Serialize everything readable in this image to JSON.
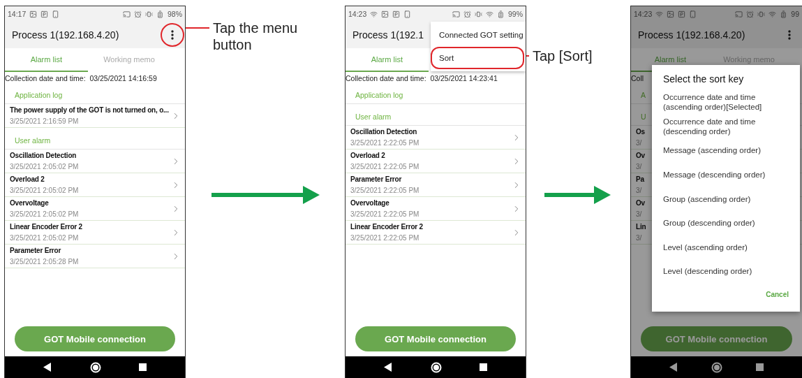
{
  "steps": [
    {
      "status_bar": {
        "time": "14:17",
        "wifi": false,
        "battery": "98%"
      },
      "app_bar": {
        "title": "Process 1(192.168.4.20)",
        "menu_button": {
          "highlighted": true
        }
      },
      "tabs": [
        {
          "label": "Alarm list",
          "selected": true
        },
        {
          "label": "Working memo",
          "selected": false
        }
      ],
      "collection": "Collection date and time:  03/25/2021 14:16:59",
      "sections": [
        {
          "heading": "Application log",
          "items": [
            {
              "title": "The power supply of the GOT is not turned on, o...",
              "date": "3/25/2021 2:16:59 PM"
            }
          ]
        },
        {
          "heading": "User alarm",
          "items": [
            {
              "title": "Oscillation Detection",
              "date": "3/25/2021 2:05:02 PM"
            },
            {
              "title": "Overload 2",
              "date": "3/25/2021 2:05:02 PM"
            },
            {
              "title": "Overvoltage",
              "date": "3/25/2021 2:05:02 PM"
            },
            {
              "title": "Linear Encoder Error 2",
              "date": "3/25/2021 2:05:02 PM"
            },
            {
              "title": "Parameter Error",
              "date": "3/25/2021 2:05:28 PM"
            }
          ]
        }
      ],
      "button": "GOT Mobile connection",
      "dimmed": false,
      "callout": "Tap the menu button"
    },
    {
      "status_bar": {
        "time": "14:23",
        "wifi": true,
        "battery": "99%"
      },
      "app_bar": {
        "title": "Process 1(192.1"
      },
      "tabs": [
        {
          "label": "Alarm list",
          "selected": true
        }
      ],
      "collection": "Collection date and time:  03/25/2021 14:23:41",
      "sections": [
        {
          "heading": "Application log"
        },
        {
          "heading": "User alarm",
          "items": [
            {
              "title": "Oscillation Detection",
              "date": "3/25/2021 2:22:05 PM"
            },
            {
              "title": "Overload 2",
              "date": "3/25/2021 2:22:05 PM"
            },
            {
              "title": "Parameter Error",
              "date": "3/25/2021 2:22:05 PM"
            },
            {
              "title": "Overvoltage",
              "date": "3/25/2021 2:22:05 PM"
            },
            {
              "title": "Linear Encoder Error 2",
              "date": "3/25/2021 2:22:05 PM"
            }
          ]
        }
      ],
      "button": "GOT Mobile connection",
      "dimmed": false,
      "popup_menu": [
        {
          "label": "Connected GOT setting",
          "highlighted": false
        },
        {
          "label": "Sort",
          "highlighted": true
        }
      ],
      "callout": "Tap [Sort]"
    },
    {
      "status_bar": {
        "time": "14:23",
        "wifi": true,
        "battery": "99"
      },
      "app_bar": {
        "title": "Process 1(192.168.4.20)",
        "menu_button": {
          "highlighted": false
        }
      },
      "tabs": [
        {
          "label": "Alarm list",
          "selected": true
        },
        {
          "label": "Working memo",
          "selected": false
        }
      ],
      "collection": "Coll",
      "sections": [
        {
          "heading": "A"
        },
        {
          "heading": "U",
          "items": [
            {
              "title": "Os",
              "date": "3/"
            },
            {
              "title": "Ov",
              "date": "3/"
            },
            {
              "title": "Pa",
              "date": "3/"
            },
            {
              "title": "Ov",
              "date": "3/"
            },
            {
              "title": "Lin",
              "date": "3/"
            }
          ]
        }
      ],
      "button": "GOT Mobile connection",
      "dimmed": true,
      "dialog": {
        "title": "Select the sort key",
        "options": [
          "Occurrence date and time (ascending order)[Selected]",
          "Occurrence date and time (descending order)",
          "Message (ascending order)",
          "Message (descending order)",
          "Group (ascending order)",
          "Group (descending order)",
          "Level (ascending order)",
          "Level (descending order)"
        ],
        "cancel": "Cancel"
      }
    }
  ]
}
